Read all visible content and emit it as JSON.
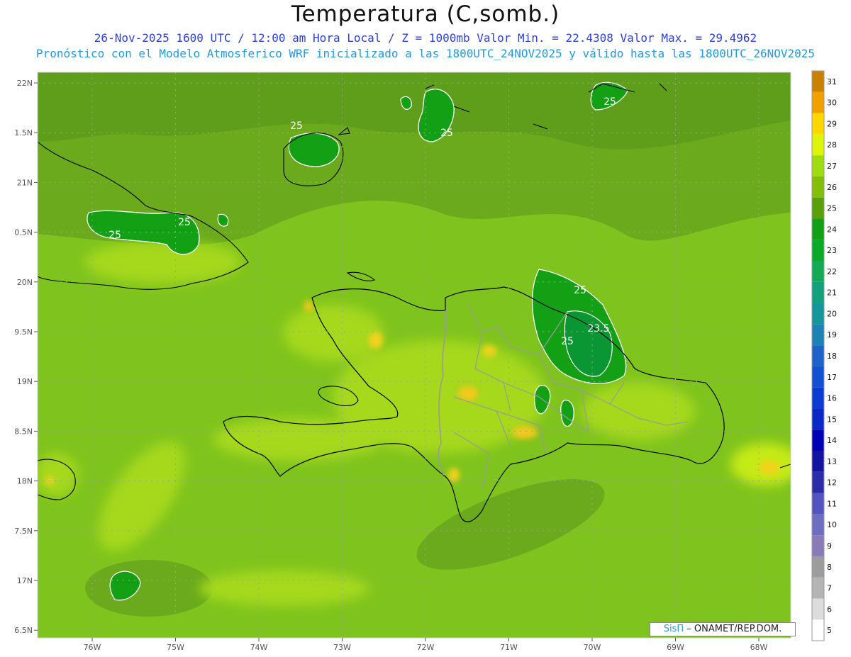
{
  "header": {
    "title": "Temperatura (C,somb.)",
    "subtitle_line1": "26-Nov-2025 1600 UTC / 12:00 am Hora Local / Z = 1000mb  Valor Min. = 22.4308  Valor Max. = 29.4962",
    "subtitle_line2": "Pronóstico con el Modelo Atmosferico WRF inicializado a las 1800UTC_24NOV2025 y válido hasta las  1800UTC_26NOV2025"
  },
  "map": {
    "lon_labels": [
      "76W",
      "75W",
      "74W",
      "73W",
      "72W",
      "71W",
      "70W",
      "69W",
      "68W"
    ],
    "lat_labels": [
      "22N",
      "1.5N",
      "21N",
      "0.5N",
      "20N",
      "9.5N",
      "19N",
      "8.5N",
      "18N",
      "7.5N",
      "17N",
      "6.5N"
    ],
    "background_color": "#7fc41e",
    "contour_labels": [
      "25",
      "25",
      "25",
      "25",
      "25",
      "25",
      "23.5",
      "25"
    ]
  },
  "colorbar": {
    "levels": [
      "5",
      "6",
      "7",
      "8",
      "9",
      "10",
      "11",
      "12",
      "13",
      "14",
      "15",
      "16",
      "17",
      "18",
      "19",
      "20",
      "21",
      "22",
      "23",
      "24",
      "25",
      "26",
      "27",
      "28",
      "29",
      "30",
      "31"
    ],
    "colors": [
      "#ffffff",
      "#dcdcdc",
      "#b4b4b4",
      "#9c9c9c",
      "#8a7ab8",
      "#6e6ec0",
      "#5454c0",
      "#2c2ca8",
      "#1414a0",
      "#0000b4",
      "#0a28c8",
      "#0a3cd2",
      "#1450d2",
      "#1e64c8",
      "#1e82b4",
      "#14969b",
      "#14a07d",
      "#14aa55",
      "#0aaa28",
      "#14a014",
      "#5aa00a",
      "#82be0a",
      "#a0dc14",
      "#dcf50a",
      "#ffd700",
      "#f0a000",
      "#c88200"
    ]
  },
  "credit": {
    "brand": "SisΠ",
    "rest": " – ONAMET/REP.DOM."
  }
}
